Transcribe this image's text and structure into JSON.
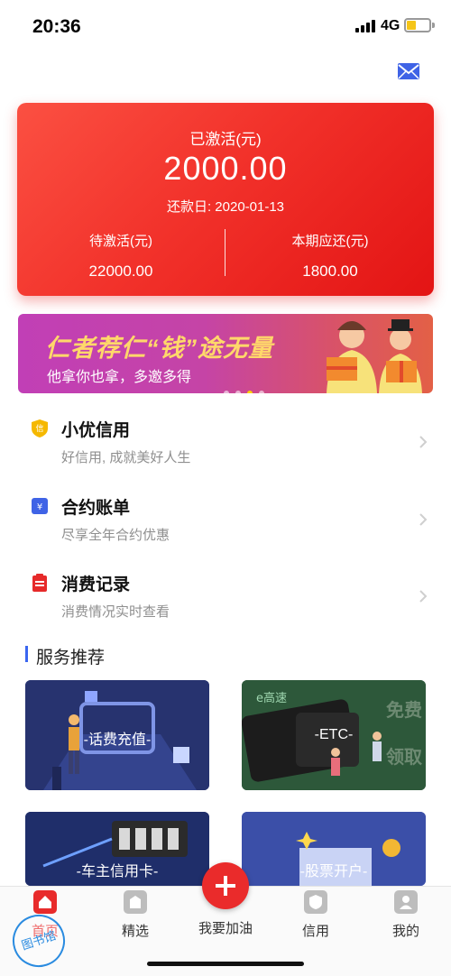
{
  "status_bar": {
    "time": "20:36",
    "network": "4G",
    "battery_level": 0.4
  },
  "header": {
    "mail_icon": "mail-icon"
  },
  "account_card": {
    "activated_label": "已激活(元)",
    "activated_amount": "2000.00",
    "repayment_date": "还款日: 2020-01-13",
    "pending_label": "待激活(元)",
    "pending_amount": "22000.00",
    "current_due_label": "本期应还(元)",
    "current_due_amount": "1800.00",
    "colors": {
      "gradient_start": "#fb5042",
      "gradient_end": "#e31414"
    }
  },
  "banner": {
    "title": "仁者荐仁“钱”途无量",
    "subtitle": "他拿你也拿，多邀多得",
    "dots_total": 4,
    "dots_active_index": 2
  },
  "list_items": [
    {
      "icon": "credit-badge-icon",
      "title": "小优信用",
      "subtitle": "好信用, 成就美好人生"
    },
    {
      "icon": "ticket-icon",
      "title": "合约账单",
      "subtitle": "尽享全年合约优惠"
    },
    {
      "icon": "receipt-icon",
      "title": "消费记录",
      "subtitle": "消费情况实时查看"
    }
  ],
  "services": {
    "title": "服务推荐",
    "tiles": [
      {
        "label": "-话费充值-"
      },
      {
        "label": "-ETC-",
        "brand": "e高速",
        "side_text": "免费领取"
      },
      {
        "label": "-车主信用卡-"
      },
      {
        "label": "-股票开户-"
      }
    ]
  },
  "tabbar": {
    "items": [
      {
        "label": "首页",
        "icon": "home-icon",
        "active": true
      },
      {
        "label": "精选",
        "icon": "featured-icon",
        "active": false
      },
      {
        "label": "我要加油",
        "icon": "plus-icon",
        "active": false
      },
      {
        "label": "信用",
        "icon": "credit-icon",
        "active": false
      },
      {
        "label": "我的",
        "icon": "profile-icon",
        "active": false
      }
    ],
    "accent": "#e82b2b"
  },
  "watermark": {
    "text": "图书馆"
  }
}
